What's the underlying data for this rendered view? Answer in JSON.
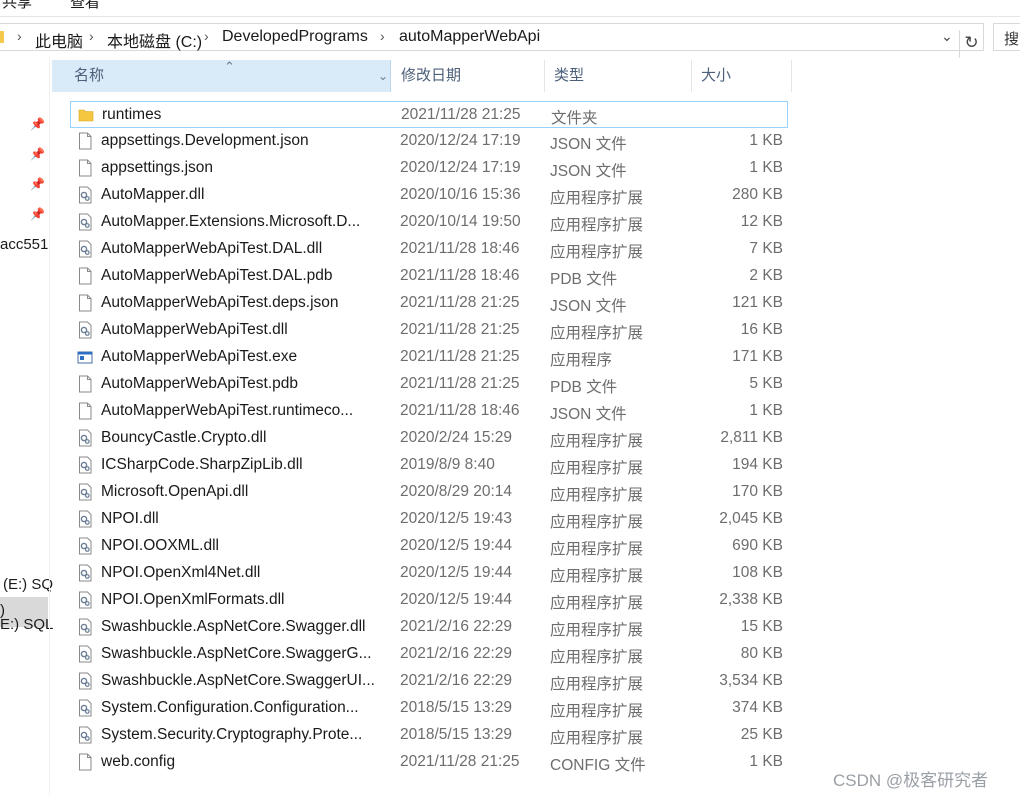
{
  "ribbon": {
    "tabs": [
      "共享",
      "查看"
    ]
  },
  "address": {
    "crumbs": [
      "此电脑",
      "本地磁盘 (C:)",
      "DevelopedPrograms",
      "autoMapperWebApi"
    ],
    "search_placeholder": "搜"
  },
  "nav": {
    "items": [
      "acc551",
      ")",
      "(E:) SQ",
      "E:) SQL"
    ]
  },
  "columns": {
    "name": "名称",
    "date": "修改日期",
    "type": "类型",
    "size": "大小"
  },
  "files": [
    {
      "name": "runtimes",
      "date": "2021/11/28 21:25",
      "type": "文件夹",
      "size": "",
      "icon": "folder-icon"
    },
    {
      "name": "appsettings.Development.json",
      "date": "2020/12/24 17:19",
      "type": "JSON 文件",
      "size": "1 KB",
      "icon": "file-icon"
    },
    {
      "name": "appsettings.json",
      "date": "2020/12/24 17:19",
      "type": "JSON 文件",
      "size": "1 KB",
      "icon": "file-icon"
    },
    {
      "name": "AutoMapper.dll",
      "date": "2020/10/16 15:36",
      "type": "应用程序扩展",
      "size": "280 KB",
      "icon": "dll-icon"
    },
    {
      "name": "AutoMapper.Extensions.Microsoft.D...",
      "date": "2020/10/14 19:50",
      "type": "应用程序扩展",
      "size": "12 KB",
      "icon": "dll-icon"
    },
    {
      "name": "AutoMapperWebApiTest.DAL.dll",
      "date": "2021/11/28 18:46",
      "type": "应用程序扩展",
      "size": "7 KB",
      "icon": "dll-icon"
    },
    {
      "name": "AutoMapperWebApiTest.DAL.pdb",
      "date": "2021/11/28 18:46",
      "type": "PDB 文件",
      "size": "2 KB",
      "icon": "file-icon"
    },
    {
      "name": "AutoMapperWebApiTest.deps.json",
      "date": "2021/11/28 21:25",
      "type": "JSON 文件",
      "size": "121 KB",
      "icon": "file-icon"
    },
    {
      "name": "AutoMapperWebApiTest.dll",
      "date": "2021/11/28 21:25",
      "type": "应用程序扩展",
      "size": "16 KB",
      "icon": "dll-icon"
    },
    {
      "name": "AutoMapperWebApiTest.exe",
      "date": "2021/11/28 21:25",
      "type": "应用程序",
      "size": "171 KB",
      "icon": "exe-icon"
    },
    {
      "name": "AutoMapperWebApiTest.pdb",
      "date": "2021/11/28 21:25",
      "type": "PDB 文件",
      "size": "5 KB",
      "icon": "file-icon"
    },
    {
      "name": "AutoMapperWebApiTest.runtimeco...",
      "date": "2021/11/28 18:46",
      "type": "JSON 文件",
      "size": "1 KB",
      "icon": "file-icon"
    },
    {
      "name": "BouncyCastle.Crypto.dll",
      "date": "2020/2/24 15:29",
      "type": "应用程序扩展",
      "size": "2,811 KB",
      "icon": "dll-icon"
    },
    {
      "name": "ICSharpCode.SharpZipLib.dll",
      "date": "2019/8/9 8:40",
      "type": "应用程序扩展",
      "size": "194 KB",
      "icon": "dll-icon"
    },
    {
      "name": "Microsoft.OpenApi.dll",
      "date": "2020/8/29 20:14",
      "type": "应用程序扩展",
      "size": "170 KB",
      "icon": "dll-icon"
    },
    {
      "name": "NPOI.dll",
      "date": "2020/12/5 19:43",
      "type": "应用程序扩展",
      "size": "2,045 KB",
      "icon": "dll-icon"
    },
    {
      "name": "NPOI.OOXML.dll",
      "date": "2020/12/5 19:44",
      "type": "应用程序扩展",
      "size": "690 KB",
      "icon": "dll-icon"
    },
    {
      "name": "NPOI.OpenXml4Net.dll",
      "date": "2020/12/5 19:44",
      "type": "应用程序扩展",
      "size": "108 KB",
      "icon": "dll-icon"
    },
    {
      "name": "NPOI.OpenXmlFormats.dll",
      "date": "2020/12/5 19:44",
      "type": "应用程序扩展",
      "size": "2,338 KB",
      "icon": "dll-icon"
    },
    {
      "name": "Swashbuckle.AspNetCore.Swagger.dll",
      "date": "2021/2/16 22:29",
      "type": "应用程序扩展",
      "size": "15 KB",
      "icon": "dll-icon"
    },
    {
      "name": "Swashbuckle.AspNetCore.SwaggerG...",
      "date": "2021/2/16 22:29",
      "type": "应用程序扩展",
      "size": "80 KB",
      "icon": "dll-icon"
    },
    {
      "name": "Swashbuckle.AspNetCore.SwaggerUI...",
      "date": "2021/2/16 22:29",
      "type": "应用程序扩展",
      "size": "3,534 KB",
      "icon": "dll-icon"
    },
    {
      "name": "System.Configuration.Configuration...",
      "date": "2018/5/15 13:29",
      "type": "应用程序扩展",
      "size": "374 KB",
      "icon": "dll-icon"
    },
    {
      "name": "System.Security.Cryptography.Prote...",
      "date": "2018/5/15 13:29",
      "type": "应用程序扩展",
      "size": "25 KB",
      "icon": "dll-icon"
    },
    {
      "name": "web.config",
      "date": "2021/11/28 21:25",
      "type": "CONFIG 文件",
      "size": "1 KB",
      "icon": "file-icon"
    }
  ],
  "watermark": "CSDN @极客研究者"
}
